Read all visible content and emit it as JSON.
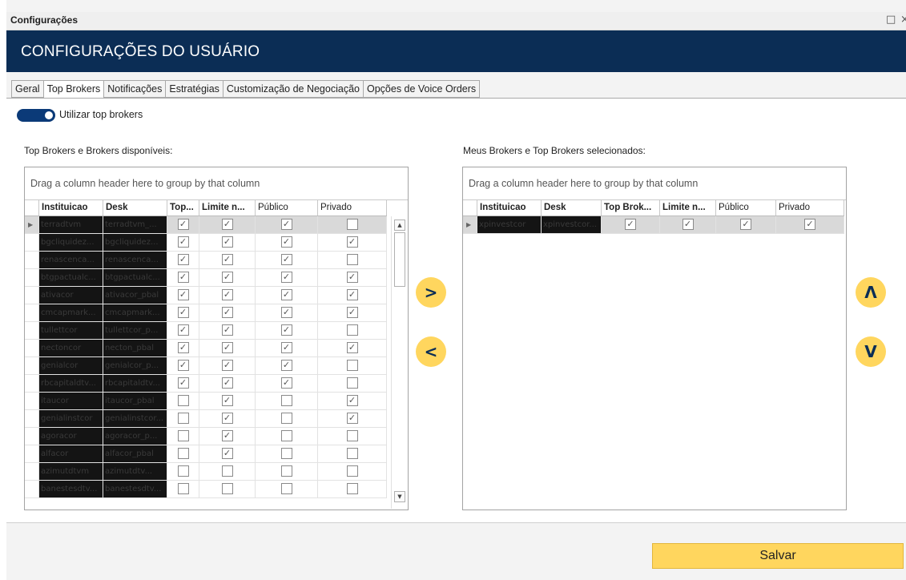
{
  "window": {
    "title": "Configurações",
    "controls": [
      "□",
      "×"
    ]
  },
  "banner": {
    "title": "CONFIGURAÇÕES DO USUÁRIO"
  },
  "tabs": [
    {
      "label": "Geral",
      "active": false
    },
    {
      "label": "Top Brokers",
      "active": true
    },
    {
      "label": "Notificações",
      "active": false
    },
    {
      "label": "Estratégias",
      "active": false
    },
    {
      "label": "Customização de Negociação",
      "active": false
    },
    {
      "label": "Opções de Voice Orders",
      "active": false
    }
  ],
  "toggle": {
    "label": "Utilizar top brokers",
    "on": true
  },
  "left_grid": {
    "section_label": "Top Brokers e Brokers disponíveis:",
    "group_hint": "Drag a column header here to group by that column",
    "columns": [
      "Instituicao",
      "Desk",
      "Top...",
      "Limite n...",
      "Público",
      "Privado"
    ],
    "rows": [
      {
        "instituicao": "terradtvm",
        "desk": "terradtvm_...",
        "top": true,
        "limite": true,
        "publico": true,
        "privado": false
      },
      {
        "instituicao": "bgcliquidez...",
        "desk": "bgcliquidez...",
        "top": true,
        "limite": true,
        "publico": true,
        "privado": true
      },
      {
        "instituicao": "renascenca...",
        "desk": "renascenca...",
        "top": true,
        "limite": true,
        "publico": true,
        "privado": false
      },
      {
        "instituicao": "btgpactualc...",
        "desk": "btgpactualc...",
        "top": true,
        "limite": true,
        "publico": true,
        "privado": true
      },
      {
        "instituicao": "ativacor",
        "desk": "ativacor_pbal",
        "top": true,
        "limite": true,
        "publico": true,
        "privado": true
      },
      {
        "instituicao": "cmcapmark...",
        "desk": "cmcapmark...",
        "top": true,
        "limite": true,
        "publico": true,
        "privado": true
      },
      {
        "instituicao": "tullettcor",
        "desk": "tullettcor_p...",
        "top": true,
        "limite": true,
        "publico": true,
        "privado": false
      },
      {
        "instituicao": "nectoncor",
        "desk": "necton_pbal",
        "top": true,
        "limite": true,
        "publico": true,
        "privado": true
      },
      {
        "instituicao": "genialcor",
        "desk": "genialcor_p...",
        "top": true,
        "limite": true,
        "publico": true,
        "privado": false
      },
      {
        "instituicao": "rbcapitaldtv...",
        "desk": "rbcapitaldtv...",
        "top": true,
        "limite": true,
        "publico": true,
        "privado": false
      },
      {
        "instituicao": "itaucor",
        "desk": "itaucor_pbal",
        "top": false,
        "limite": true,
        "publico": false,
        "privado": true
      },
      {
        "instituicao": "genialinstcor",
        "desk": "genialinstcor...",
        "top": false,
        "limite": true,
        "publico": false,
        "privado": true
      },
      {
        "instituicao": "agoracor",
        "desk": "agoracor_p...",
        "top": false,
        "limite": true,
        "publico": false,
        "privado": false
      },
      {
        "instituicao": "alfacor",
        "desk": "alfacor_pbal",
        "top": false,
        "limite": true,
        "publico": false,
        "privado": false
      },
      {
        "instituicao": "azimutdtvm",
        "desk": "azimutdtv...",
        "top": false,
        "limite": false,
        "publico": false,
        "privado": false
      },
      {
        "instituicao": "banestesdtv...",
        "desk": "banestesdtv...",
        "top": false,
        "limite": false,
        "publico": false,
        "privado": false
      }
    ]
  },
  "right_grid": {
    "section_label": "Meus Brokers e Top Brokers selecionados:",
    "group_hint": "Drag a column header here to group by that column",
    "columns": [
      "Instituicao",
      "Desk",
      "Top Brok...",
      "Limite n...",
      "Público",
      "Privado"
    ],
    "rows": [
      {
        "instituicao": "xpinvestcor",
        "desk": "xpinvestcor...",
        "top": true,
        "limite": true,
        "publico": true,
        "privado": true
      }
    ]
  },
  "transfer": {
    "add": ">",
    "remove": "<",
    "up": "Λ",
    "down": "V"
  },
  "footer": {
    "save_label": "Salvar"
  },
  "colors": {
    "banner": "#0b2d55",
    "accent": "#ffd65e",
    "toggle": "#0b3a78"
  }
}
